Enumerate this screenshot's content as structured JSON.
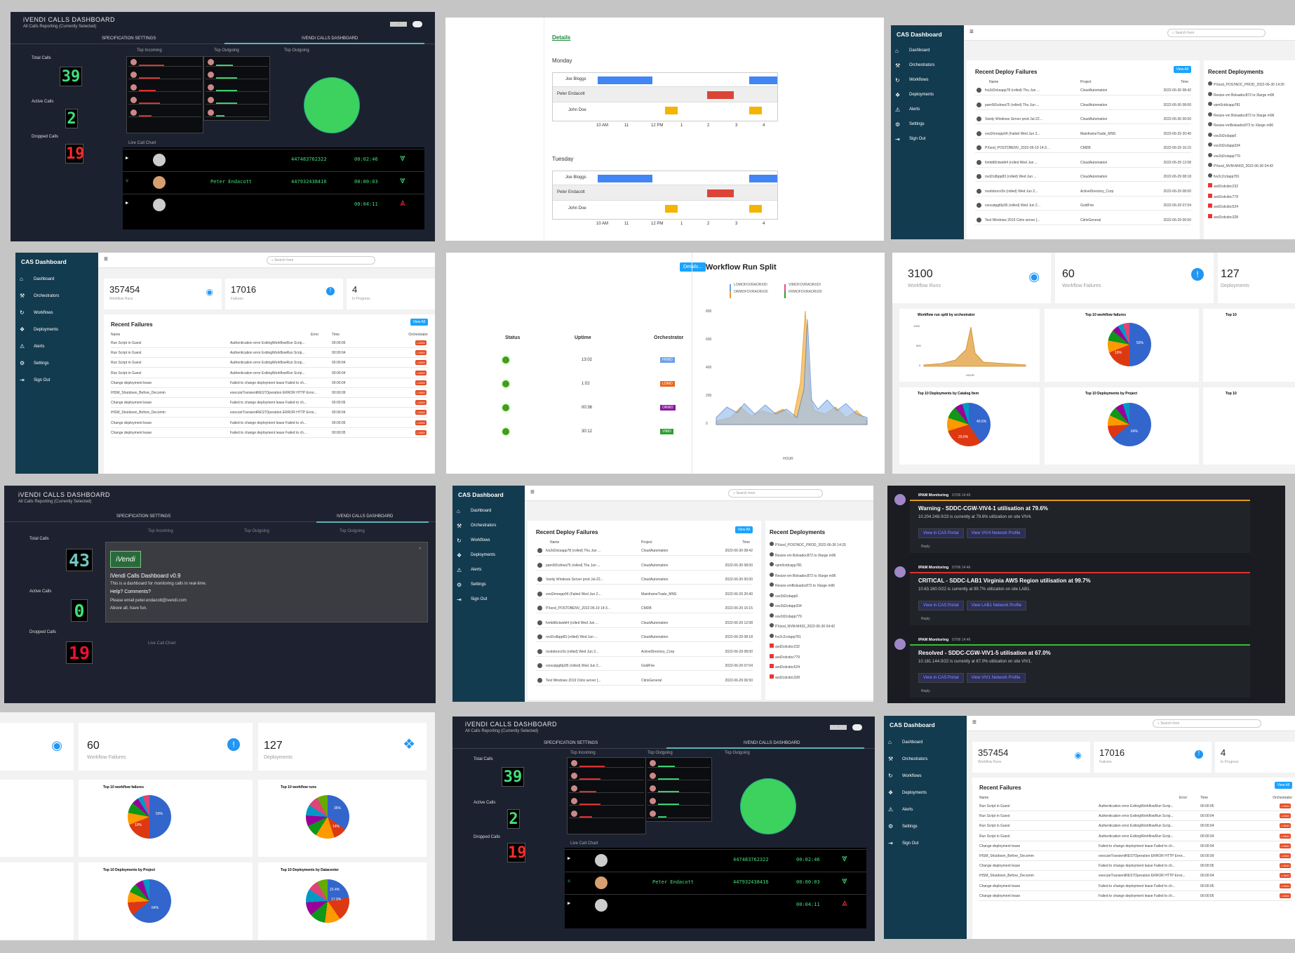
{
  "ivendi": {
    "title": "iVENDI CALLS DASHBOARD",
    "subtitle": "All Calls Reporting (Currently Selected)",
    "tab_spec": "SPECIFICATION SETTINGS",
    "tab_dash": "IVENDI CALLS DASHBOARD",
    "top_incoming": "Top Incoming",
    "top_outgoing": "Top Outgoing",
    "total_calls": "Total Calls",
    "active_calls": "Active Calls",
    "dropped_calls": "Dropped Calls",
    "total_value": "39",
    "active_value": "2",
    "dropped_value": "19",
    "live_chart": "Live Call Chart",
    "live": [
      {
        "name": "",
        "number": "447483762322",
        "time": "00:02:46"
      },
      {
        "name": "Peter Endacott",
        "number": "447932438416",
        "time": "00:00:03"
      },
      {
        "name": "",
        "number": "",
        "time": "00:04:11"
      }
    ]
  },
  "ivendi_modal": {
    "title": "iVENDI CALLS DASHBOARD",
    "subtitle": "All Calls Reporting (Currently Selected)",
    "total_value": "43",
    "active_value": "0",
    "dropped_value": "19",
    "logo": "iVendi",
    "heading": "iVendi Calls Dashboard v0.9",
    "line1": "This is a dashboard for monitoring calls in real-time.",
    "line2": "Help? Comments?",
    "line3": "Please email peter.endacott@ivendi.com",
    "line4": "Above all, have fun."
  },
  "schedule": {
    "link": "Details",
    "days": [
      "Monday",
      "Tuesday"
    ],
    "people": [
      "Joe Bloggs",
      "Peter Endacott",
      "John Doe"
    ],
    "ticks": [
      "10\nAM",
      "11",
      "12\nPM",
      "1",
      "2",
      "3",
      "4"
    ]
  },
  "cas": {
    "brand": "CAS Dashboard",
    "search": "Search here",
    "nav": [
      "Dashboard",
      "Orchestrators",
      "Workflows",
      "Deployments",
      "Alerts",
      "Settings",
      "Sign Out"
    ],
    "recent_deploy_failures": "Recent Deploy Failures",
    "recent_deployments": "Recent Deployments",
    "view_all": "View All",
    "col_name": "Name",
    "col_project": "Project",
    "col_time": "Time",
    "deploy_rows": [
      {
        "name": "fvs2d2cksapp78 (rolled) Thu Jun ...",
        "project": "CloudAutomation",
        "time": "2022-06-30 08:42"
      },
      {
        "name": "pam0t2cdrwa75 (rolled) Thu Jun ...",
        "project": "CloudAutomation",
        "time": "2022-06-30 08:00"
      },
      {
        "name": "Vanity Windows Server prod Jul-22...",
        "project": "CloudAutomation",
        "time": "2022-06-30 00:00"
      },
      {
        "name": "vsvt2mnopp04 (Failed Wed Jun 2...",
        "project": "MainframeTrade_MNS",
        "time": "2022-06-29 20:40"
      },
      {
        "name": "PXsod_POSTDBENV_2022-06-19 14:3...",
        "project": "CMDB",
        "time": "2022-06-29 16:15"
      },
      {
        "name": "fvmldt0ctwebl4 (rolled Wed Jun ...",
        "project": "CloudAutomation",
        "time": "2022-06-29 12:08"
      },
      {
        "name": "rsvt2cdbpp83 (rolled) Wed Jun ...",
        "project": "CloudAutomation",
        "time": "2022-06-29 08:18"
      },
      {
        "name": "rsvdoborcr0s (rolled) Wed Jun 2...",
        "project": "ActiveDirectory_Corp",
        "time": "2022-06-29 08:00"
      },
      {
        "name": "vsocatpgt0p95 (rolled) Wed Jun 2...",
        "project": "GoldFire",
        "time": "2022-06-29 07:04"
      },
      {
        "name": "Test Windows 2019 Citrix server [...",
        "project": "CitrixGeneral",
        "time": "2022-06-29 06:50"
      }
    ],
    "deploy_list": [
      "PXsod_POSTADC_PROD_2022-06-30 14:20",
      "Resize-vm Bolsadoc872 to Xlarge m96",
      "vpm0ctdcapp781",
      "Resize-vm Bolsadoc872 to Xlarge m96",
      "Resize-vmBolsadoc872 to Xlarge m96",
      "vsv2d2cdapp0",
      "vsv2d2cdapp334",
      "vsv2d2cdapp779",
      "PXsod_NVM-M433_2022-06-30 04:42",
      "fvv2c2crtapp781",
      "avd2cdcdoc232",
      "avd2cdcdoc779",
      "avd2cdcdoc524",
      "avd2cdcdoc328"
    ],
    "stat1": "357454",
    "stat1_cap": "Workflow Runs",
    "stat2": "17016",
    "stat2_cap": "Failures",
    "stat3": "4",
    "stat3_cap": "In Progress",
    "recent_failures": "Recent Failures",
    "col_error": "Error",
    "col_orch": "Orchestrator",
    "fail_rows": [
      {
        "name": "Run Script in Guest",
        "error": "Authentication error ExitingWorkflowRun Scrip...",
        "time": "00:00:05"
      },
      {
        "name": "Run Script in Guest",
        "error": "Authentication error ExitingWorkflowRun Scrip...",
        "time": "00:00:04"
      },
      {
        "name": "Run Script in Guest",
        "error": "Authentication error ExitingWorkflowRun Scrip...",
        "time": "00:00:04"
      },
      {
        "name": "Run Script in Guest",
        "error": "Authentication error ExitingWorkflowRun Scrip...",
        "time": "00:00:04"
      },
      {
        "name": "Change deployment lease",
        "error": "Failed to change deployment lease Failed to ch...",
        "time": "00:00:04"
      },
      {
        "name": "IHSM_Shutdown_Before_Decomm",
        "error": "executeTransientRESTOperation ERROR HTTP Error...",
        "time": "00:00:09"
      },
      {
        "name": "Change deployment lease",
        "error": "Failed to change deployment lease Failed to ch...",
        "time": "00:00:05"
      },
      {
        "name": "IHSM_Shutdown_Before_Decomm",
        "error": "executeTransientRESTOperation ERROR HTTP Error...",
        "time": "00:00:04"
      },
      {
        "name": "Change deployment lease",
        "error": "Failed to change deployment lease Failed to ch...",
        "time": "00:00:05"
      },
      {
        "name": "Change deployment lease",
        "error": "Failed to change deployment lease Failed to ch...",
        "time": "00:00:05"
      }
    ],
    "orch_badge": "LOMO"
  },
  "orch": {
    "details": "Details...",
    "col_status": "Status",
    "col_uptime": "Uptime",
    "col_orch": "Orchestrator",
    "rows": [
      {
        "uptime": "13:02",
        "orch": "FRMO",
        "color": "#6aa0e8"
      },
      {
        "uptime": "1:02",
        "orch": "LOMO",
        "color": "#e8671c"
      },
      {
        "uptime": "00:36",
        "orch": "ORMO",
        "color": "#8a1aa0"
      },
      {
        "uptime": "30:12",
        "orch": "VIMO",
        "color": "#2ca02c"
      }
    ]
  },
  "split": {
    "title": "Workflow Run Split",
    "legend": [
      "LOMOFOVRAORXDI",
      "ORMOFOVRAORXDI",
      "VIMOFOVRAORXDI",
      "FRMOFOVRAORXDI"
    ],
    "yticks": [
      "800",
      "600",
      "400",
      "200",
      "0"
    ],
    "xlabel": "HOUR"
  },
  "stats2": {
    "runs": "3100",
    "runs_cap": "Workflow Runs",
    "fails": "60",
    "fails_cap": "Workflow Failures",
    "deps": "127",
    "deps_cap": "Deployments",
    "c1": "Workflow run split by orchestrator",
    "c2": "Top 10 workflow failures",
    "c3": "Top 10 Deployments by Catalog Item",
    "c4": "Top 10 Deployments by Project",
    "c5": "Top 10 workflow runs",
    "c6": "Top 10 Deployments by Datacenter",
    "p1": "50%",
    "p2": "19%",
    "p3": "40.6%",
    "p4": "29.6%",
    "p5": "64%",
    "p6": "35%",
    "p7": "14%",
    "p8": "22.4%",
    "p9": "17.9%",
    "yt": [
      "1000",
      "500",
      "0"
    ],
    "hour": "HOUR",
    "top10_runs_short": "Top 10"
  },
  "ipam": {
    "app": "IPAM Monitoring",
    "reply": "Reply",
    "alerts": [
      {
        "time": "07/06 14:46",
        "title": "Warning - SDDC-CGW-VIV4-1 utilisation at 79.6%",
        "detail": "10.204.248.0/23 is currently at 79.6% utilization on site VIV4.",
        "b1": "View in CAS Portal",
        "b2": "View VIV4 Network Profile",
        "color": "#e09a19"
      },
      {
        "time": "07/06 14:46",
        "title": "CRITICAL - SDDC-LAB1 Virginia AWS Region utilisation at 99.7%",
        "detail": "10.63.160.0/22 is currently at 99.7% utilization on site LAB1.",
        "b1": "View in CAS Portal",
        "b2": "View LAB1 Network Profile",
        "color": "#e03030"
      },
      {
        "time": "07/06 14:46",
        "title": "Resolved - SDDC-CGW-VIV1-5 utilisation at 67.0%",
        "detail": "10.181.144.0/22 is currently at 67.0% utilization on site VIV1.",
        "b1": "View in CAS Portal",
        "b2": "View VIV1 Network Profile",
        "color": "#30c030"
      }
    ]
  }
}
